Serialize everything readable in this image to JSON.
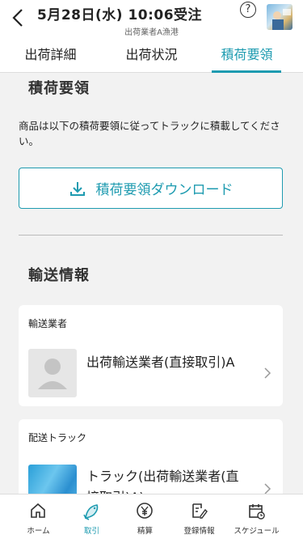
{
  "header": {
    "title": "5月28日(水) 10:06受注",
    "subtitle": "出荷業者A漁港",
    "help": "?"
  },
  "tabs": [
    {
      "label": "出荷詳細",
      "active": false
    },
    {
      "label": "出荷状況",
      "active": false
    },
    {
      "label": "積荷要領",
      "active": true
    }
  ],
  "loading": {
    "heading": "積荷要領",
    "description": "商品は以下の積荷要領に従ってトラックに積載してください。",
    "download_label": "積荷要領ダウンロード"
  },
  "transport": {
    "heading": "輸送情報",
    "carrier_label": "輸送業者",
    "carrier_name": "出荷輸送業者(直接取引)A",
    "truck_label": "配送トラック",
    "truck_name": "トラック(出荷輸送業者(直接取引)A)"
  },
  "nav": [
    {
      "label": "ホーム",
      "icon": "home-icon",
      "active": false
    },
    {
      "label": "取引",
      "icon": "fish-icon",
      "active": true
    },
    {
      "label": "精算",
      "icon": "yen-icon",
      "active": false
    },
    {
      "label": "登録情報",
      "icon": "edit-document-icon",
      "active": false
    },
    {
      "label": "スケジュール",
      "icon": "calendar-icon",
      "active": false
    }
  ],
  "colors": {
    "accent": "#1e9bb0"
  }
}
